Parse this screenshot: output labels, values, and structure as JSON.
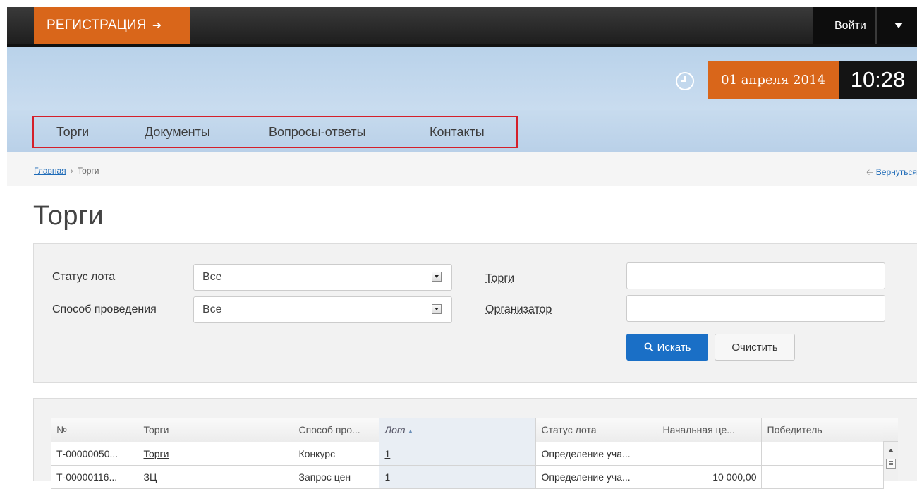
{
  "topbar": {
    "register_label": "РЕГИСТРАЦИЯ",
    "register_arrow": "➜",
    "login_label": "Войти"
  },
  "header": {
    "date": "01 апреля 2014",
    "time": "10:28"
  },
  "nav": {
    "items": [
      {
        "label": "Торги"
      },
      {
        "label": "Документы"
      },
      {
        "label": "Вопросы-ответы"
      },
      {
        "label": "Контакты"
      }
    ]
  },
  "breadcrumb": {
    "home": "Главная",
    "separator": "›",
    "current": "Торги",
    "back_label": "Вернуться"
  },
  "page": {
    "title": "Торги"
  },
  "filters": {
    "lot_status_label": "Статус лота",
    "lot_status_value": "Все",
    "method_label": "Способ проведения",
    "method_value": "Все",
    "auctions_label": "Торги",
    "organizer_label": "Организатор",
    "search_button": "Искать",
    "clear_button": "Очистить"
  },
  "table": {
    "columns": [
      "№",
      "Торги",
      "Способ про...",
      "Лот",
      "Статус лота",
      "Начальная це...",
      "Победитель"
    ],
    "rows": [
      [
        "Т-00000050...",
        "Торги",
        "Конкурс",
        "1",
        "Определение уча...",
        "",
        ""
      ],
      [
        "Т-00000116...",
        "ЗЦ",
        "Запрос цен",
        "1",
        "Определение уча...",
        "10 000,00",
        ""
      ]
    ]
  },
  "colors": {
    "accent_orange": "#d9661a",
    "primary_blue": "#1a6fc6",
    "highlight_red": "#d41f2a"
  }
}
